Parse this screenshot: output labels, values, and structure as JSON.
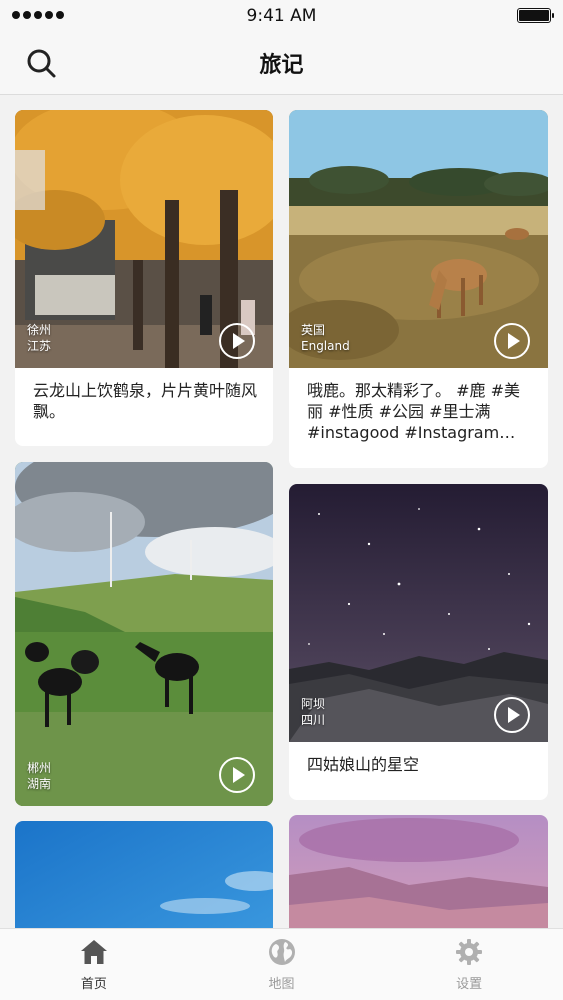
{
  "status_bar": {
    "time": "9:41 AM"
  },
  "nav": {
    "title": "旅记"
  },
  "cards": [
    {
      "location_line1": "徐州",
      "location_line2": "江苏",
      "caption": "云龙山上饮鹤泉，片片黄叶随风飘。"
    },
    {
      "location_line1": "英国",
      "location_line2": "England",
      "caption": "哦鹿。那太精彩了。 #鹿 #美丽 #性质 #公园 #里士满 #instagood #Instagram…"
    },
    {
      "location_line1": "郴州",
      "location_line2": "湖南",
      "caption": ""
    },
    {
      "location_line1": "阿坝",
      "location_line2": "四川",
      "caption": "四姑娘山的星空"
    }
  ],
  "tabs": [
    {
      "label": "首页",
      "icon": "home-icon",
      "active": true
    },
    {
      "label": "地图",
      "icon": "globe-icon",
      "active": false
    },
    {
      "label": "设置",
      "icon": "gear-icon",
      "active": false
    }
  ],
  "colors": {
    "active_icon": "#555555",
    "inactive_icon": "#b0b0b0"
  }
}
